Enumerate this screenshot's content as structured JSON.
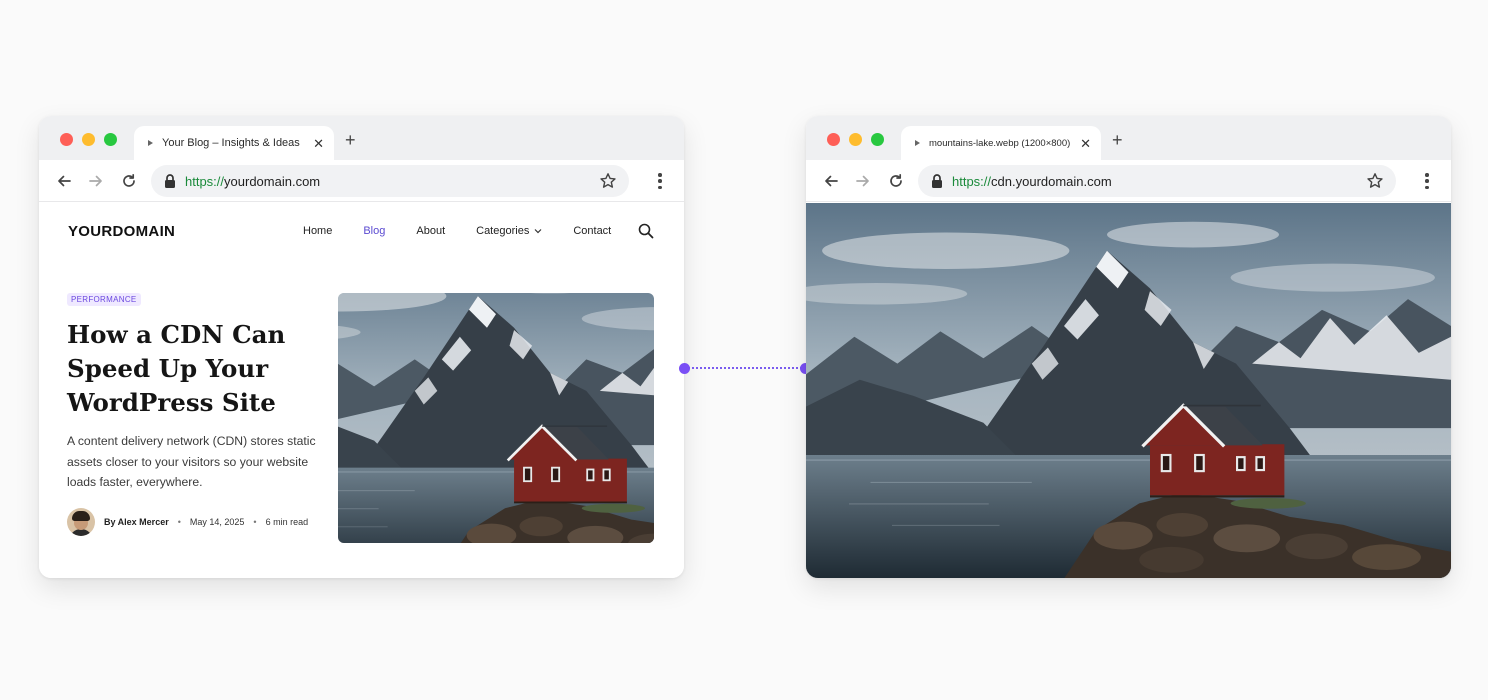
{
  "left_window": {
    "tab_title": "Your Blog – Insights & Ideas",
    "tab_close": "✕",
    "new_tab": "+",
    "url_scheme": "https://",
    "url_host": "yourdomain.com",
    "site": {
      "logo": "YOURDOMAIN",
      "nav": {
        "home": "Home",
        "blog": "Blog",
        "about": "About",
        "categories": "Categories",
        "contact": "Contact"
      },
      "active_nav": "Blog",
      "accent_color": "#5b4bd1"
    },
    "article": {
      "tag": "PERFORMANCE",
      "title": "How a CDN Can Speed Up Your WordPress Site",
      "excerpt": "A content delivery network (CDN) stores static assets closer to your visitors so your website loads faster, everywhere.",
      "author": "By Alex Mercer",
      "date": "May 14, 2025",
      "read_time": "6 min read",
      "separator": "•"
    }
  },
  "right_window": {
    "tab_title": "mountains-lake.webp (1200×800)",
    "tab_close": "✕",
    "new_tab": "+",
    "url_scheme": "https://",
    "url_host": "cdn.yourdomain.com"
  },
  "icons": [
    "back-arrow-icon",
    "forward-arrow-icon",
    "reload-icon",
    "lock-icon",
    "star-icon",
    "menu-dots-icon",
    "search-icon",
    "chevron-down-icon",
    "favicon-icon"
  ],
  "colors": {
    "connector": "#7a4ff5",
    "url_scheme": "#1a8a3a",
    "traffic_red": "#fe5f57",
    "traffic_yellow": "#febc2e",
    "traffic_green": "#28c840"
  }
}
